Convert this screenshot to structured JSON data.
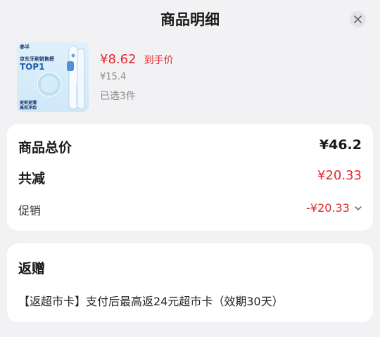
{
  "header": {
    "title": "商品明细"
  },
  "product": {
    "image": {
      "brand": "参半",
      "line1": "京东牙刷销售榜",
      "line2": "TOP1",
      "line3a": "更密更薄",
      "line3b": "高效净齿"
    },
    "price": "¥8.62",
    "price_tag": "到手价",
    "original_price": "¥15.4",
    "selected_count": "已选3件"
  },
  "summary": {
    "total_label": "商品总价",
    "total_value": "¥46.2",
    "reduce_label": "共减",
    "reduce_value": "¥20.33",
    "promo_label": "促销",
    "promo_value": "-¥20.33"
  },
  "gift": {
    "title": "返赠",
    "text": "【返超市卡】支付后最高返24元超市卡（效期30天）"
  },
  "colors": {
    "accent_red": "#e4252b",
    "background": "#f2f2f4"
  }
}
